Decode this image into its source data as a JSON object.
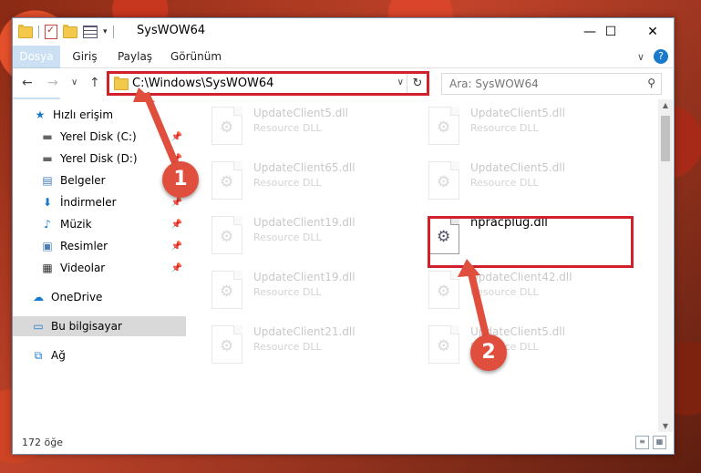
{
  "window": {
    "title": "SysWOW64",
    "buttons": {
      "minimize": "—",
      "maximize": "☐",
      "close": "✕"
    }
  },
  "ribbon": {
    "tabs": [
      "Dosya",
      "Giriş",
      "Paylaş",
      "Görünüm"
    ],
    "collapse": "∨",
    "help": "?"
  },
  "nav": {
    "back": "←",
    "forward": "→",
    "recent": "∨",
    "up": "↑",
    "address": "C:\\Windows\\SysWOW64",
    "address_dropdown": "∨",
    "refresh": "↻",
    "search_placeholder": "Ara: SysWOW64",
    "search_icon": "⚲"
  },
  "sidebar": {
    "items": [
      {
        "label": "Hızlı erişim",
        "icon": "star-icon",
        "glyph": "★",
        "pinned": false,
        "selected": false
      },
      {
        "label": "Yerel Disk (C:)",
        "icon": "drive-icon",
        "glyph": "▬",
        "pinned": true,
        "selected": false
      },
      {
        "label": "Yerel Disk (D:)",
        "icon": "drive-icon",
        "glyph": "▬",
        "pinned": true,
        "selected": false
      },
      {
        "label": "Belgeler",
        "icon": "documents-icon",
        "glyph": "▤",
        "pinned": true,
        "selected": false
      },
      {
        "label": "İndirmeler",
        "icon": "download-icon",
        "glyph": "⬇",
        "pinned": true,
        "selected": false
      },
      {
        "label": "Müzik",
        "icon": "music-icon",
        "glyph": "♪",
        "pinned": true,
        "selected": false
      },
      {
        "label": "Resimler",
        "icon": "pictures-icon",
        "glyph": "▣",
        "pinned": true,
        "selected": false
      },
      {
        "label": "Videolar",
        "icon": "video-icon",
        "glyph": "▦",
        "pinned": true,
        "selected": false
      },
      {
        "label": "OneDrive",
        "icon": "cloud-icon",
        "glyph": "☁",
        "pinned": false,
        "selected": false
      },
      {
        "label": "Bu bilgisayar",
        "icon": "computer-icon",
        "glyph": "▭",
        "pinned": false,
        "selected": true
      },
      {
        "label": "Ağ",
        "icon": "network-icon",
        "glyph": "⧉",
        "pinned": false,
        "selected": false
      }
    ],
    "pin_glyph": "📌"
  },
  "files": [
    {
      "name": "UpdateClient5.dll",
      "type": "Resource DLL",
      "active": false
    },
    {
      "name": "UpdateClient5.dll",
      "type": "Resource DLL",
      "active": false
    },
    {
      "name": "UpdateClient65.dll",
      "type": "Resource DLL",
      "active": false
    },
    {
      "name": "UpdateClient5.dll",
      "type": "Resource DLL",
      "active": false
    },
    {
      "name": "UpdateClient19.dll",
      "type": "Resource DLL",
      "active": false
    },
    {
      "name": "npracplug.dll",
      "type": "",
      "active": true
    },
    {
      "name": "UpdateClient19.dll",
      "type": "Resource DLL",
      "active": false
    },
    {
      "name": "UpdateClient42.dll",
      "type": "Resource DLL",
      "active": false
    },
    {
      "name": "UpdateClient21.dll",
      "type": "Resource DLL",
      "active": false
    },
    {
      "name": "UpdateClient5.dll",
      "type": "Resource DLL",
      "active": false
    }
  ],
  "status": {
    "count": "172 öğe"
  },
  "annotations": {
    "step1": "1",
    "step2": "2",
    "arrow_color": "#e04f3e",
    "box_color": "#d2202a"
  }
}
